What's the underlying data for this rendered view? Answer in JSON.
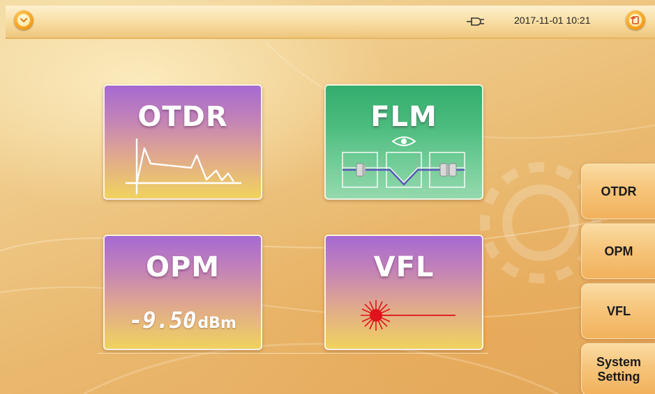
{
  "status_bar": {
    "datetime": "2017-11-01 10:21",
    "power_icon": "plug-icon",
    "menu_icon": "chevron-down-icon",
    "exit_icon": "exit-icon"
  },
  "tiles": {
    "otdr": {
      "title": "OTDR",
      "icon": "otdr-trace-icon"
    },
    "flm": {
      "title": "FLM",
      "icon": "fiber-link-map-icon"
    },
    "opm": {
      "title": "OPM",
      "value": "-9.50",
      "unit": "dBm"
    },
    "vfl": {
      "title": "VFL",
      "icon": "laser-icon"
    }
  },
  "sidebar": {
    "items": [
      {
        "label": "OTDR"
      },
      {
        "label": "OPM"
      },
      {
        "label": "VFL"
      },
      {
        "label": "System\nSetting"
      }
    ]
  },
  "colors": {
    "background": "#eec784",
    "accent_orange": "#f39a18",
    "tile_purple": "#a56ad2",
    "tile_yellow": "#f0d35e",
    "tile_green": "#33ad6d",
    "laser_red": "#e0121b"
  }
}
